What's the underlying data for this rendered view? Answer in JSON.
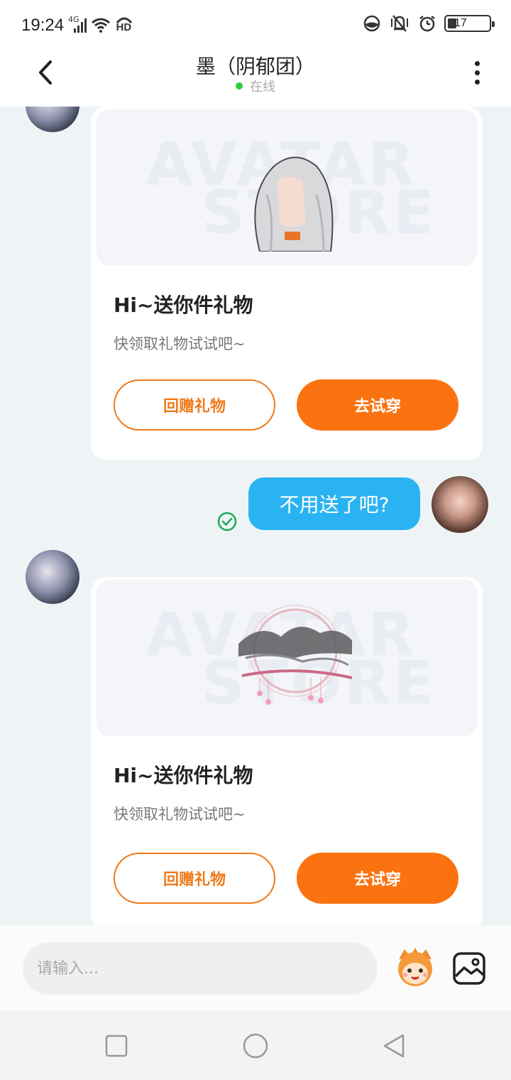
{
  "status_bar": {
    "time": "19:24",
    "network": "4G",
    "hd": "HD",
    "battery": "17"
  },
  "header": {
    "title": "墨（阴郁团）",
    "status": "在线"
  },
  "messages": [
    {
      "type": "gift_card",
      "side": "left",
      "watermark_1": "AVATAR",
      "watermark_2": "STORE",
      "title": "Hi~送你件礼物",
      "desc": "快领取礼物试试吧~",
      "button_return": "回赠礼物",
      "button_try": "去试穿"
    },
    {
      "type": "text",
      "side": "right",
      "text": "不用送了吧?",
      "delivered": true
    },
    {
      "type": "gift_card",
      "side": "left",
      "watermark_1": "AVATAR",
      "watermark_2": "STORE",
      "title": "Hi~送你件礼物",
      "desc": "快领取礼物试试吧~",
      "button_return": "回赠礼物",
      "button_try": "去试穿"
    }
  ],
  "input": {
    "placeholder": "请输入..."
  },
  "colors": {
    "accent_orange": "#fb7310",
    "bubble_blue": "#2ab3f2",
    "online_green": "#2ecc40",
    "check_green": "#1aaa55"
  },
  "icons": [
    "back-icon",
    "more-icon",
    "check-circle-icon",
    "emoji-mascot-icon",
    "image-icon",
    "nav-recents-icon",
    "nav-home-icon",
    "nav-back-icon"
  ]
}
